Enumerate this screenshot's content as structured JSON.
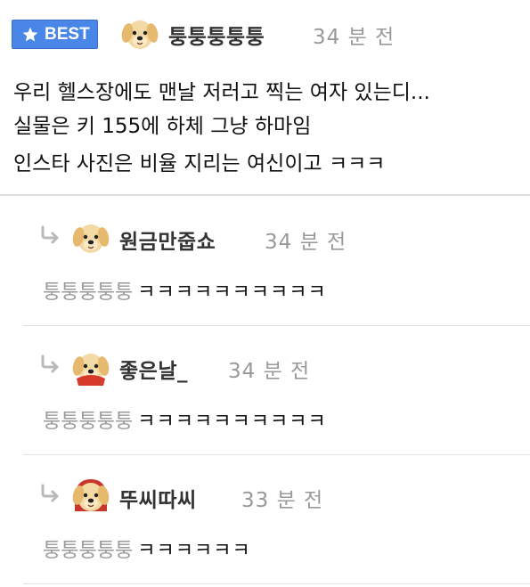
{
  "best": {
    "badge": "BEST",
    "author": "퉁퉁퉁퉁퉁",
    "time": "34 분 전",
    "lines": [
      "우리 헬스장에도 맨날 저러고 찍는 여자 있는디...",
      "실물은 키 155에 하체 그냥 하마임",
      "인스타 사진은 비율 지리는 여신이고 ㅋㅋㅋ"
    ]
  },
  "replies": [
    {
      "author": "원금만줍쇼",
      "time": "34 분 전",
      "mention": "퉁퉁퉁퉁퉁",
      "text": "ㅋㅋㅋㅋㅋㅋㅋㅋㅋㅋ",
      "avatar": "dog-icon"
    },
    {
      "author": "좋은날_",
      "time": "34 분 전",
      "mention": "퉁퉁퉁퉁퉁",
      "text": "ㅋㅋㅋㅋㅋㅋㅋㅋㅋㅋ",
      "avatar": "dog-red-cape-icon"
    },
    {
      "author": "뚜씨따씨",
      "time": "33 분 전",
      "mention": "퉁퉁퉁퉁퉁",
      "text": "ㅋㅋㅋㅋㅋㅋ",
      "avatar": "dog-red-hood-icon"
    }
  ],
  "colors": {
    "badge": "#4a86e8",
    "author": "#333333",
    "time": "#999999",
    "mention": "#9a9a9a"
  }
}
